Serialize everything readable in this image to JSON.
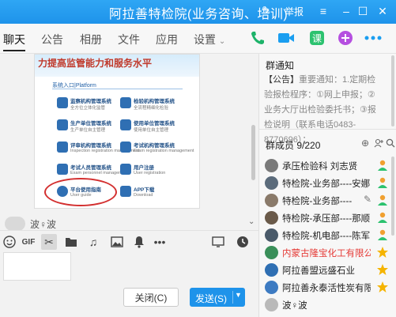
{
  "window": {
    "title": "阿拉善特检院(业务咨询、培训)",
    "report_label": "举报"
  },
  "tabs": [
    {
      "label": "聊天"
    },
    {
      "label": "公告"
    },
    {
      "label": "相册"
    },
    {
      "label": "文件"
    },
    {
      "label": "应用"
    },
    {
      "label": "设置"
    }
  ],
  "toolbar_icons": [
    "phone-icon",
    "video-icon",
    "classroom-icon",
    "plus-icon",
    "more-icon"
  ],
  "shared_image": {
    "banner": "力提高监管能力和服务水平",
    "section_title": "系统入口|Platform",
    "items": [
      {
        "name": "监察机构管理系统",
        "sub": "全方位立体化监管"
      },
      {
        "name": "检验机构管理系统",
        "sub": "全流程精细化检验"
      },
      {
        "name": "生产单位管理系统",
        "sub": "生产单位自主管理"
      },
      {
        "name": "使用单位管理系统",
        "sub": "使用单位自主管理"
      },
      {
        "name": "评审机构管理系统",
        "sub": "Inspection registration management"
      },
      {
        "name": "考试机构管理系统",
        "sub": "Exam registration management"
      },
      {
        "name": "考试人员管理系统",
        "sub": "Exam personnel management"
      },
      {
        "name": "用户注册",
        "sub": "User registration"
      },
      {
        "name": "平台使用指南",
        "sub": "User guide"
      },
      {
        "name": "APP下载",
        "sub": "Download"
      }
    ]
  },
  "message_sender": "波♀波",
  "input": {
    "close_label": "关闭(C)",
    "send_label": "发送(S)"
  },
  "notice": {
    "title": "群通知",
    "text_bold": "【公告】",
    "text_rest": "重要通知：1.定期检验报检程序：①网上申报；②业务大厅出检验委托书；③报检说明（联系电话0483-8770696）；"
  },
  "members": {
    "title": "群成员 9/220",
    "list": [
      {
        "name": "承压检验科 刘志贤",
        "red": false,
        "badge": "admin",
        "avatar_color": "#7a7a7a"
      },
      {
        "name": "特检院-业务部----安娜",
        "red": false,
        "badge": "admin",
        "avatar_color": "#5b6b7b"
      },
      {
        "name": "特检院-业务部----",
        "red": false,
        "badge": "admin",
        "avatar_color": "#8a7a6a"
      },
      {
        "name": "特检院-承压部----那顺",
        "red": false,
        "badge": "admin",
        "avatar_color": "#6a5a4a"
      },
      {
        "name": "特检院-机电部----陈军",
        "red": false,
        "badge": "admin",
        "avatar_color": "#4a5a6a"
      },
      {
        "name": "内蒙古隆宝化工有限公司",
        "red": true,
        "badge": "star",
        "avatar_color": "#3a8f5a"
      },
      {
        "name": "阿拉善盟远盛石业",
        "red": false,
        "badge": "star",
        "avatar_color": "#2f6fb3"
      },
      {
        "name": "阿拉善永泰活性炭有限公司",
        "red": false,
        "badge": "star",
        "avatar_color": "#3d7bc2"
      },
      {
        "name": "波♀波",
        "red": false,
        "badge": "",
        "avatar_color": "#b9b9b9"
      }
    ]
  },
  "colors": {
    "accent": "#1e93ea",
    "phone_green": "#1db36a",
    "video_blue": "#1a9ef0",
    "classroom_green": "#2cc26f",
    "plus_purple": "#b54fe0",
    "red_name": "#e53935"
  }
}
